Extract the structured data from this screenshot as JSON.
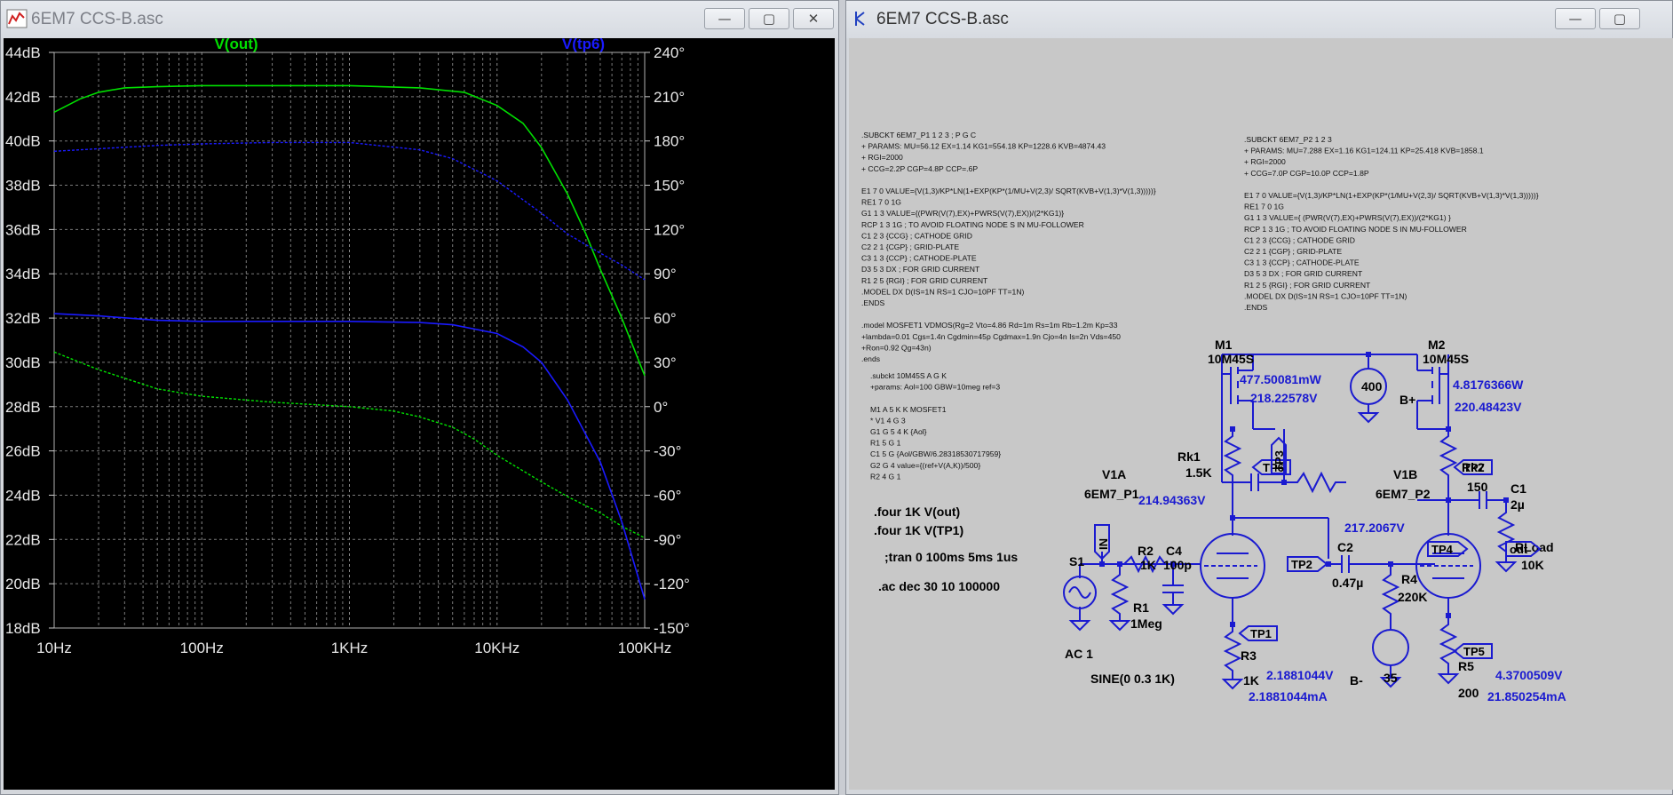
{
  "windows": {
    "plot": {
      "title": "6EM7 CCS-B.asc",
      "minimize": "—",
      "maximize": "▢",
      "close": "✕"
    },
    "schematic": {
      "title": "6EM7 CCS-B.asc",
      "minimize": "—",
      "maximize": "▢"
    }
  },
  "chart_data": {
    "type": "line",
    "x_scale": "log",
    "xlim": [
      10,
      100000
    ],
    "left_axis": {
      "ylim": [
        18,
        44
      ],
      "unit": "dB",
      "ticks": [
        "44dB",
        "42dB",
        "40dB",
        "38dB",
        "36dB",
        "34dB",
        "32dB",
        "30dB",
        "28dB",
        "26dB",
        "24dB",
        "22dB",
        "20dB",
        "18dB"
      ]
    },
    "right_axis": {
      "ylim": [
        -150,
        240
      ],
      "unit": "°",
      "ticks": [
        "240°",
        "210°",
        "180°",
        "150°",
        "120°",
        "90°",
        "60°",
        "30°",
        "0°",
        "-30°",
        "-60°",
        "-90°",
        "-120°",
        "-150°"
      ]
    },
    "x_ticks": [
      "10Hz",
      "100Hz",
      "1KHz",
      "10KHz",
      "100KHz"
    ],
    "grid": true,
    "series": [
      {
        "name": "V(out)",
        "color": "#00e000",
        "magnitude_db": [
          [
            10,
            41.3
          ],
          [
            15,
            41.9
          ],
          [
            20,
            42.2
          ],
          [
            30,
            42.4
          ],
          [
            50,
            42.45
          ],
          [
            100,
            42.5
          ],
          [
            1000,
            42.5
          ],
          [
            3000,
            42.4
          ],
          [
            6000,
            42.2
          ],
          [
            10000,
            41.6
          ],
          [
            15000,
            40.8
          ],
          [
            20000,
            39.7
          ],
          [
            30000,
            37.6
          ],
          [
            40000,
            35.8
          ],
          [
            50000,
            34.2
          ],
          [
            70000,
            32.0
          ],
          [
            100000,
            29.4
          ]
        ],
        "phase_deg": [
          [
            10,
            37
          ],
          [
            20,
            25
          ],
          [
            50,
            12
          ],
          [
            100,
            7
          ],
          [
            300,
            3
          ],
          [
            1000,
            0
          ],
          [
            2000,
            -3
          ],
          [
            3000,
            -7
          ],
          [
            5000,
            -14
          ],
          [
            7000,
            -22
          ],
          [
            10000,
            -33
          ],
          [
            20000,
            -51
          ],
          [
            30000,
            -61
          ],
          [
            50000,
            -72
          ],
          [
            70000,
            -81
          ],
          [
            100000,
            -89
          ]
        ]
      },
      {
        "name": "V(tp6)",
        "color": "#1a1aff",
        "magnitude_db": [
          [
            10,
            32.2
          ],
          [
            20,
            32.1
          ],
          [
            50,
            31.9
          ],
          [
            100,
            31.85
          ],
          [
            1000,
            31.85
          ],
          [
            3000,
            31.8
          ],
          [
            5000,
            31.7
          ],
          [
            10000,
            31.3
          ],
          [
            15000,
            30.7
          ],
          [
            20000,
            30.0
          ],
          [
            30000,
            28.3
          ],
          [
            50000,
            25.5
          ],
          [
            70000,
            22.8
          ],
          [
            100000,
            19.3
          ]
        ],
        "phase_deg": [
          [
            10,
            173
          ],
          [
            50,
            177
          ],
          [
            100,
            178
          ],
          [
            300,
            179
          ],
          [
            1000,
            179
          ],
          [
            3000,
            174
          ],
          [
            5000,
            168
          ],
          [
            10000,
            153
          ],
          [
            20000,
            131
          ],
          [
            30000,
            117
          ],
          [
            50000,
            104
          ],
          [
            70000,
            96
          ],
          [
            100000,
            86
          ]
        ]
      }
    ]
  },
  "schematic": {
    "netlist_left": [
      ".SUBCKT 6EM7_P1 1 2 3 ; P G C",
      "+ PARAMS: MU=56.12 EX=1.14 KG1=554.18 KP=1228.6 KVB=4874.43",
      "+ RGI=2000",
      "+ CCG=2.2P CGP=4.8P CCP=.6P",
      "",
      "E1 7 0 VALUE={V(1,3)/KP*LN(1+EXP(KP*(1/MU+V(2,3)/ SQRT(KVB+V(1,3)*V(1,3)))))}",
      "RE1 7 0 1G",
      "G1 1 3 VALUE={(PWR(V(7),EX)+PWRS(V(7),EX))/(2*KG1)}",
      "RCP 1 3 1G ; TO AVOID FLOATING NODE S IN MU-FOLLOWER",
      "C1 2 3 {CCG} ; CATHODE GRID",
      "C2 2 1 {CGP} ; GRID-PLATE",
      "C3 1 3 {CCP} ; CATHODE-PLATE",
      "D3 5 3 DX ; FOR GRID CURRENT",
      "R1 2 5 {RGI} ; FOR GRID CURRENT",
      ".MODEL DX D(IS=1N RS=1 CJO=10PF TT=1N)",
      ".ENDS",
      "",
      ".model MOSFET1 VDMOS(Rg=2 Vto=4.86 Rd=1m Rs=1m Rb=1.2m Kp=33",
      "+lambda=0.01 Cgs=1.4n Cgdmin=45p Cgdmax=1.9n Cjo=4n Is=2n Vds=450",
      "+Ron=0.92 Qg=43n)",
      ".ends"
    ],
    "netlist_sub": [
      ".subckt 10M45S A G K",
      "+params: Aol=100 GBW=10meg ref=3",
      "",
      "M1 A 5 K K MOSFET1",
      "* V1 4 G 3",
      "G1 G 5 4 K {Aol}",
      "R1 5 G 1",
      "C1 5 G {Aol/GBW/6.28318530717959}",
      "G2 G 4 value={(ref+V(A,K))/500}",
      "R2 4 G 1"
    ],
    "netlist_right": [
      ".SUBCKT 6EM7_P2 1 2 3",
      "+ PARAMS: MU=7.288 EX=1.16 KG1=124.11 KP=25.418 KVB=1858.1",
      "+ RGI=2000",
      "+ CCG=7.0P CGP=10.0P CCP=1.8P",
      "",
      "E1 7 0 VALUE={V(1,3)/KP*LN(1+EXP(KP*(1/MU+V(2,3)/ SQRT(KVB+V(1,3)*V(1,3)))))}",
      "RE1 7 0 1G",
      "G1 1 3 VALUE={ (PWR(V(7),EX)+PWRS(V(7),EX))/(2*KG1) }",
      "RCP 1 3 1G ; TO AVOID FLOATING NODE S IN MU-FOLLOWER",
      "C1 2 3 {CCG} ; CATHODE GRID",
      "C2 2 1 {CGP} ; GRID-PLATE",
      "C3 1 3 {CCP} ; CATHODE-PLATE",
      "D3 5 3 DX ; FOR GRID CURRENT",
      "R1 2 5 {RGI} ; FOR GRID CURRENT",
      ".MODEL DX D(IS=1N RS=1 CJO=10PF TT=1N)",
      ".ENDS"
    ],
    "directives": {
      "four1": ".four 1K V(out)",
      "four2": ".four 1K V(TP1)",
      "tran": ";tran 0 100ms 5ms 1us",
      "ac": ".ac dec 30 10 100000"
    },
    "labels": {
      "m1": "M1",
      "m1_part": "10M45S",
      "m2": "M2",
      "m2_part": "10M45S",
      "m1_power": "477.50081mW",
      "m1_v": "218.22578V",
      "m2_power": "4.8176366W",
      "m2_v": "220.48423V",
      "bplus_val": "400",
      "bplus": "B+",
      "v1a": "V1A",
      "v1a_part": "6EM7_P1",
      "v1b": "V1B",
      "v1b_part": "6EM7_P2",
      "rk1": "Rk1",
      "rk1_val": "1.5K",
      "rk2": "Rk2",
      "rk2_val": "150",
      "c1": "C1",
      "c1_val": "2µ",
      "rload": "RLoad",
      "rload_val": "10K",
      "v_grid1": "214.94363V",
      "v_grid2": "217.2067V",
      "s1": "S1",
      "in": "IN",
      "r2": "R2",
      "r2_val": "1K",
      "c4": "C4",
      "c4_val": "100p",
      "r1": "R1",
      "r1_val": "1Meg",
      "ac1": "AC 1",
      "sine": "SINE(0 0.3 1K)",
      "c2": "C2",
      "c2_val": "0.47µ",
      "r4": "R4",
      "r4_val": "220K",
      "r3": "R3",
      "r3_val": "1K",
      "tp1_v": "2.1881044V",
      "tp1_i": "2.1881044mA",
      "bminus": "B-",
      "bminus_val": "35",
      "r5": "R5",
      "r5_val": "200",
      "tp5_v": "4.3700509V",
      "tp5_i": "21.850254mA",
      "tp1": "TP1",
      "tp2": "TP2",
      "tp3": "TP3",
      "tp4": "TP4",
      "tp5": "TP5",
      "tp6": "TP6",
      "tp7": "TP7",
      "out": "out"
    }
  }
}
